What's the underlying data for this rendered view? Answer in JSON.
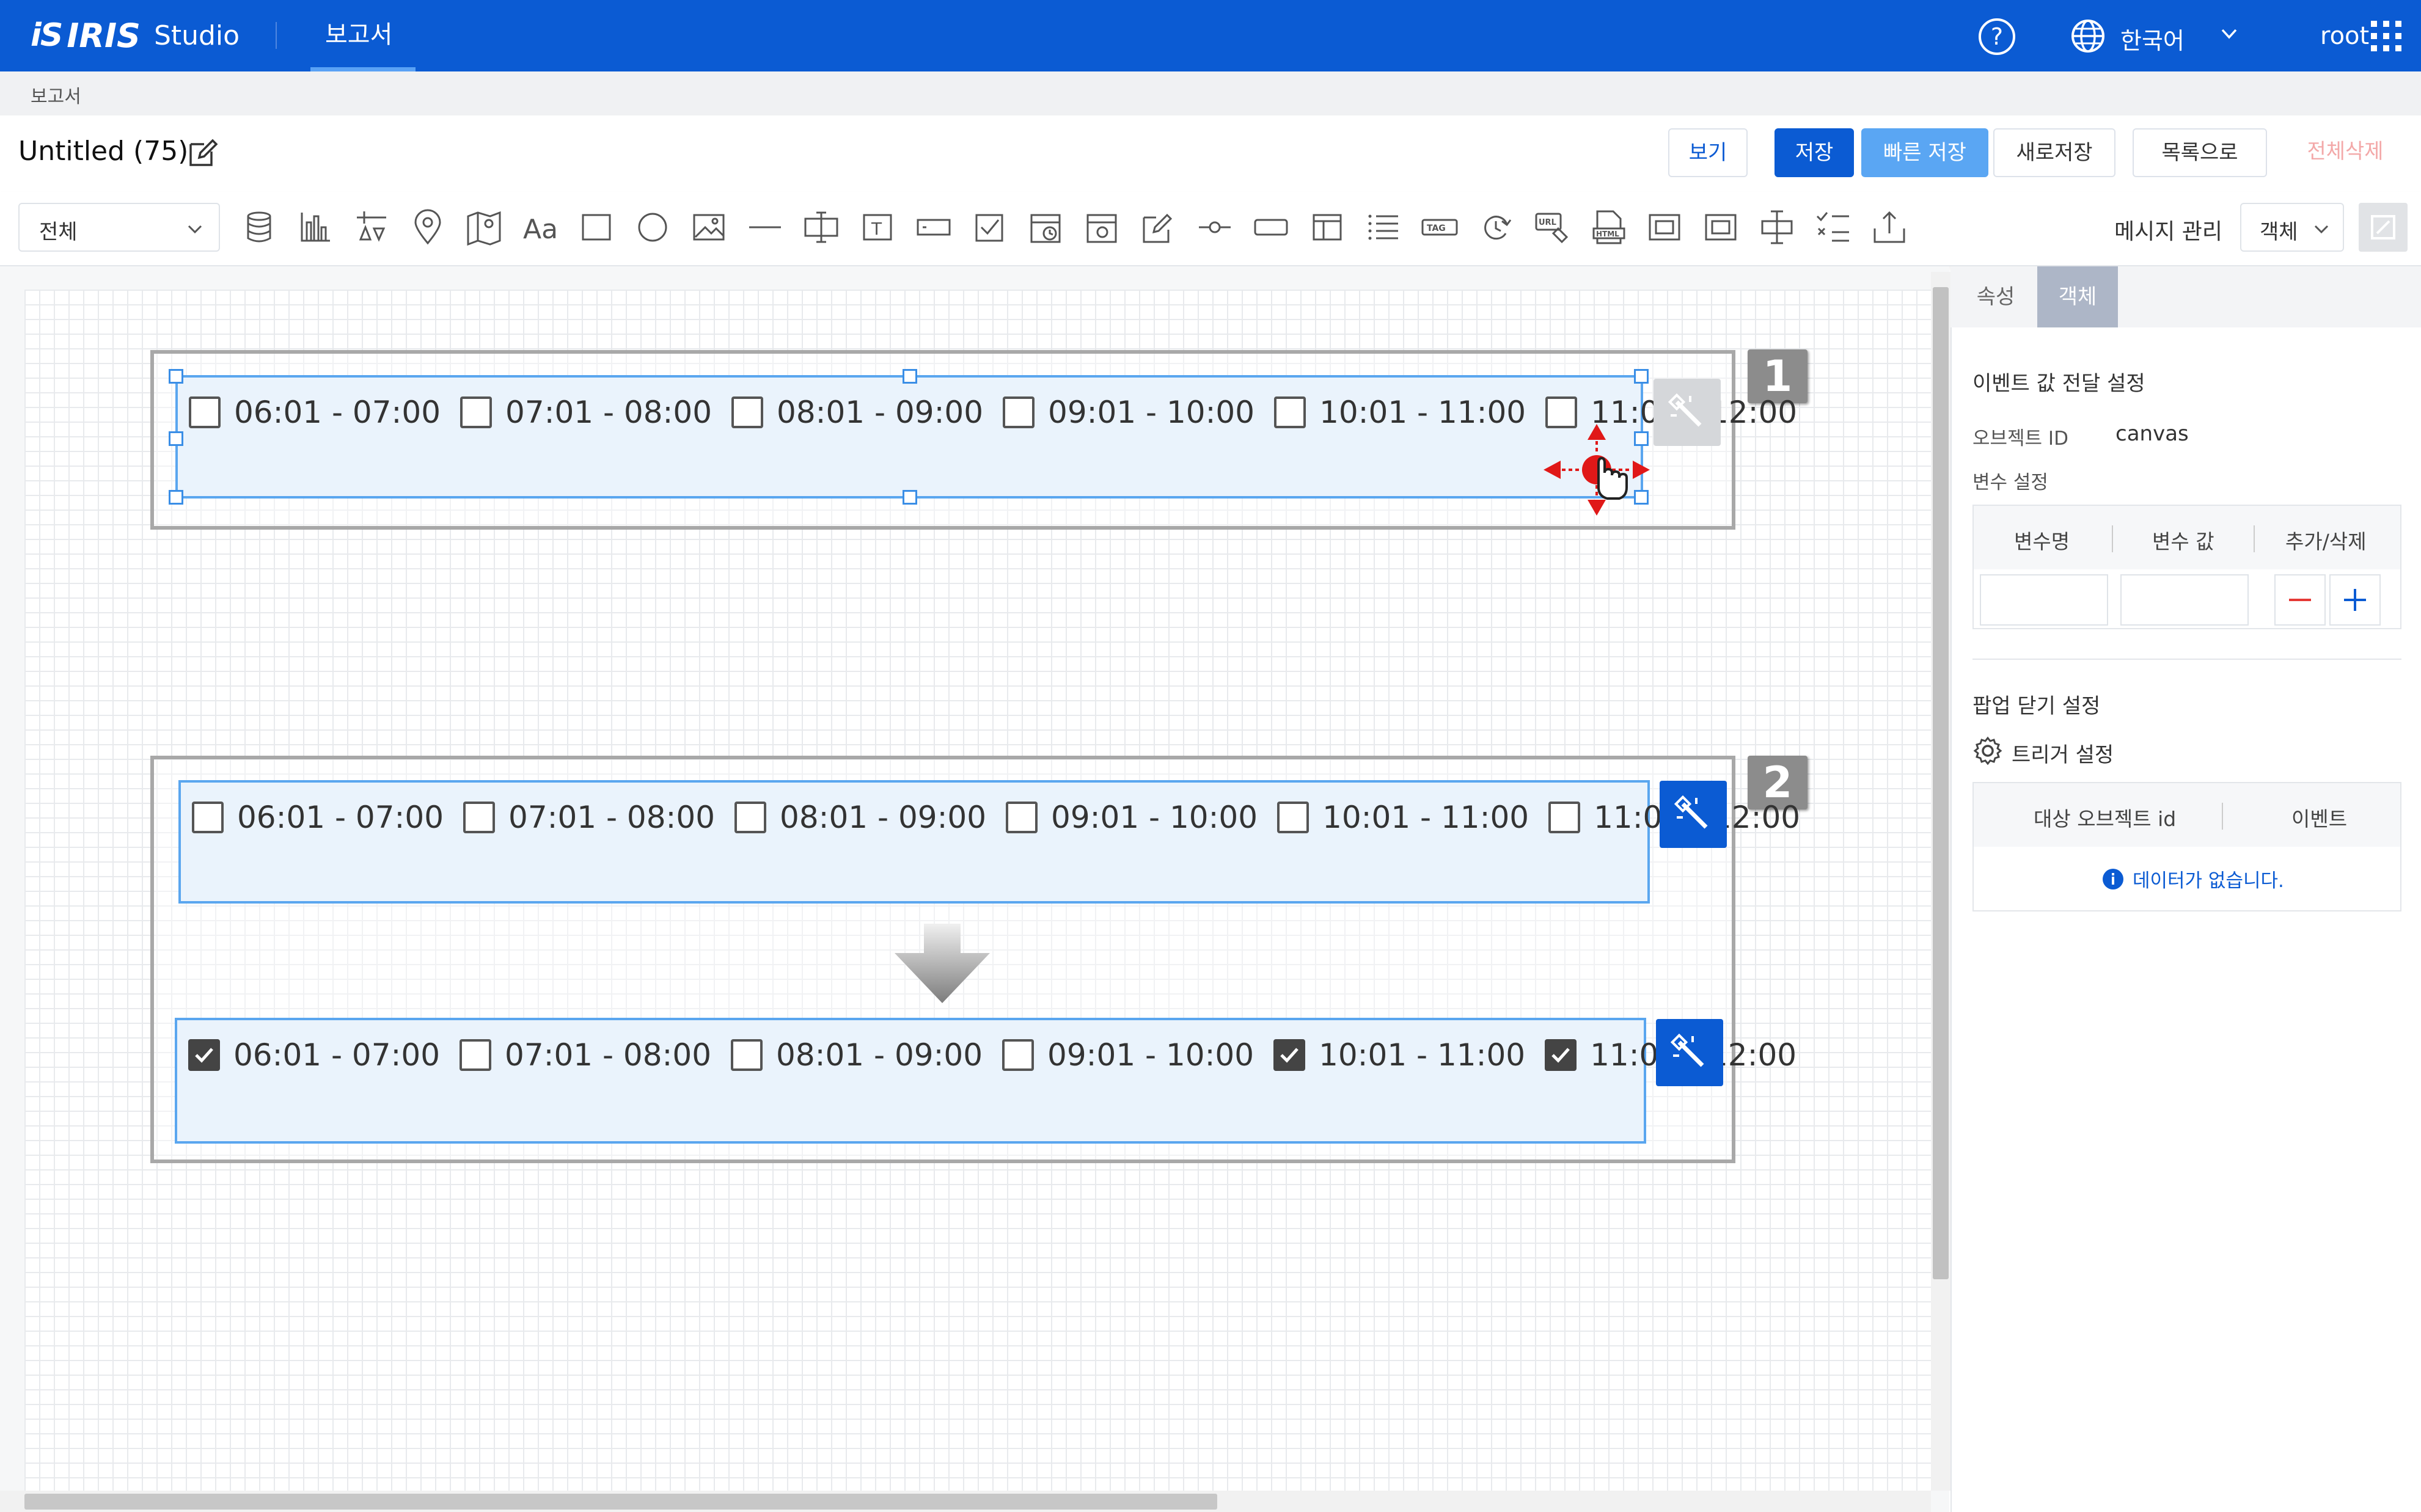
{
  "app": {
    "logo_mark": "iS",
    "brand": "IRIS",
    "product": "Studio",
    "nav_tab": "보고서",
    "language": "한국어",
    "user": "root"
  },
  "breadcrumb": "보고서",
  "report": {
    "title": "Untitled (75)"
  },
  "actions": {
    "view": "보기",
    "save": "저장",
    "quick_save": "빠른 저장",
    "save_as": "새로저장",
    "to_list": "목록으로",
    "delete_all": "전체삭제"
  },
  "toolbar": {
    "filter_value": "전체",
    "message_manage": "메시지 관리",
    "object_select": "객체",
    "tools": [
      "database-icon",
      "bar-chart-icon",
      "filter-icon",
      "map-pin-icon",
      "map-icon",
      "text-icon",
      "rectangle-icon",
      "circle-icon",
      "image-icon",
      "line-icon",
      "text-input-icon",
      "text-box-icon",
      "input-field-icon",
      "checkbox-icon",
      "date-picker-icon",
      "date-range-icon",
      "edit-icon",
      "slider-icon",
      "button-icon",
      "panel-icon",
      "list-icon",
      "tag-icon",
      "refresh-icon",
      "url-icon",
      "html-icon",
      "popup-icon",
      "frame-icon",
      "cursor-text-icon",
      "checklist-icon",
      "upload-icon"
    ]
  },
  "canvas": {
    "frame1": {
      "badge": "1",
      "items": [
        {
          "label": "06:01 - 07:00",
          "checked": false
        },
        {
          "label": "07:01 - 08:00",
          "checked": false
        },
        {
          "label": "08:01 - 09:00",
          "checked": false
        },
        {
          "label": "09:01 - 10:00",
          "checked": false
        },
        {
          "label": "10:01 - 11:00",
          "checked": false
        },
        {
          "label": "11:01 - 12:00",
          "checked": false
        }
      ]
    },
    "frame2": {
      "badge": "2",
      "before": [
        {
          "label": "06:01 - 07:00",
          "checked": false
        },
        {
          "label": "07:01 - 08:00",
          "checked": false
        },
        {
          "label": "08:01 - 09:00",
          "checked": false
        },
        {
          "label": "09:01 - 10:00",
          "checked": false
        },
        {
          "label": "10:01 - 11:00",
          "checked": false
        },
        {
          "label": "11:01 - 12:00",
          "checked": false
        }
      ],
      "after": [
        {
          "label": "06:01 - 07:00",
          "checked": true
        },
        {
          "label": "07:01 - 08:00",
          "checked": false
        },
        {
          "label": "08:01 - 09:00",
          "checked": false
        },
        {
          "label": "09:01 - 10:00",
          "checked": false
        },
        {
          "label": "10:01 - 11:00",
          "checked": true
        },
        {
          "label": "11:01 - 12:00",
          "checked": true
        }
      ]
    }
  },
  "panel": {
    "tabs": [
      "속성",
      "객체"
    ],
    "active_tab": "객체",
    "event_section": "이벤트 값 전달 설정",
    "object_id_label": "오브젝트 ID",
    "object_id_value": "canvas",
    "var_section": "변수 설정",
    "var_columns": [
      "변수명",
      "변수 값",
      "추가/삭제"
    ],
    "popup_section": "팝업 닫기 설정",
    "trigger_label": "트리거 설정",
    "trigger_columns": [
      "대상 오브젝트 id",
      "이벤트"
    ],
    "no_data": "데이터가 없습니다."
  },
  "colors": {
    "primary": "#0b5bd3",
    "quick_save": "#5aa6f3",
    "selection": "#5aa6ef",
    "danger": "#e53935",
    "delete_disabled": "#f3a9a9"
  }
}
